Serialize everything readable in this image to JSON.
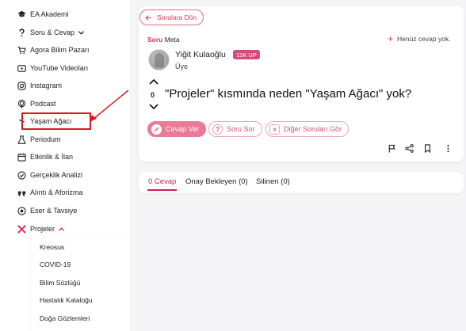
{
  "sidebar": {
    "items": [
      {
        "label": "EA Akademi",
        "icon": "graduation-cap-icon"
      },
      {
        "label": "Soru & Cevap",
        "icon": "question-icon"
      },
      {
        "label": "Agora Bilim Pazarı",
        "icon": "cart-icon"
      },
      {
        "label": "YouTube Videoları",
        "icon": "play-icon"
      },
      {
        "label": "Instagram",
        "icon": "instagram-icon"
      },
      {
        "label": "Podcast",
        "icon": "podcast-icon"
      },
      {
        "label": "Yaşam Ağacı",
        "icon": "tree-icon"
      },
      {
        "label": "Periodum",
        "icon": "flask-icon"
      },
      {
        "label": "Etkinlik & İlan",
        "icon": "calendar-icon"
      },
      {
        "label": "Gerçeklik Analizi",
        "icon": "check-circle-icon"
      },
      {
        "label": "Alıntı & Aforizma",
        "icon": "quote-icon"
      },
      {
        "label": "Eser & Tavsiye",
        "icon": "book-icon"
      },
      {
        "label": "Projeler",
        "icon": "projects-icon"
      }
    ],
    "sub_items": [
      "Kreosus",
      "COVID-19",
      "Bilim Sözlüğü",
      "Hastalık Kataloğu",
      "Doğa Gözlemleri"
    ]
  },
  "main": {
    "back_label": "Sorulara Dön",
    "soru_label": "Soru",
    "meta_label": "Meta",
    "no_answer": "Henüz cevap yok.",
    "user": {
      "name": "Yiğit Kulaoğlu",
      "badge": "12K UP",
      "role": "Üye"
    },
    "vote_count": "0",
    "question_title": "\"Projeler\" kısmında neden \"Yaşam Ağacı\" yok?",
    "actions": {
      "answer": "Cevap Ver",
      "ask": "Soru Sor",
      "see_others": "Diğer Soruları Gör"
    },
    "tabs": [
      "0 Cevap",
      "Onay Bekleyen (0)",
      "Silinen (0)"
    ]
  },
  "colors": {
    "accent": "#e0315a",
    "highlight": "#d31d24"
  }
}
